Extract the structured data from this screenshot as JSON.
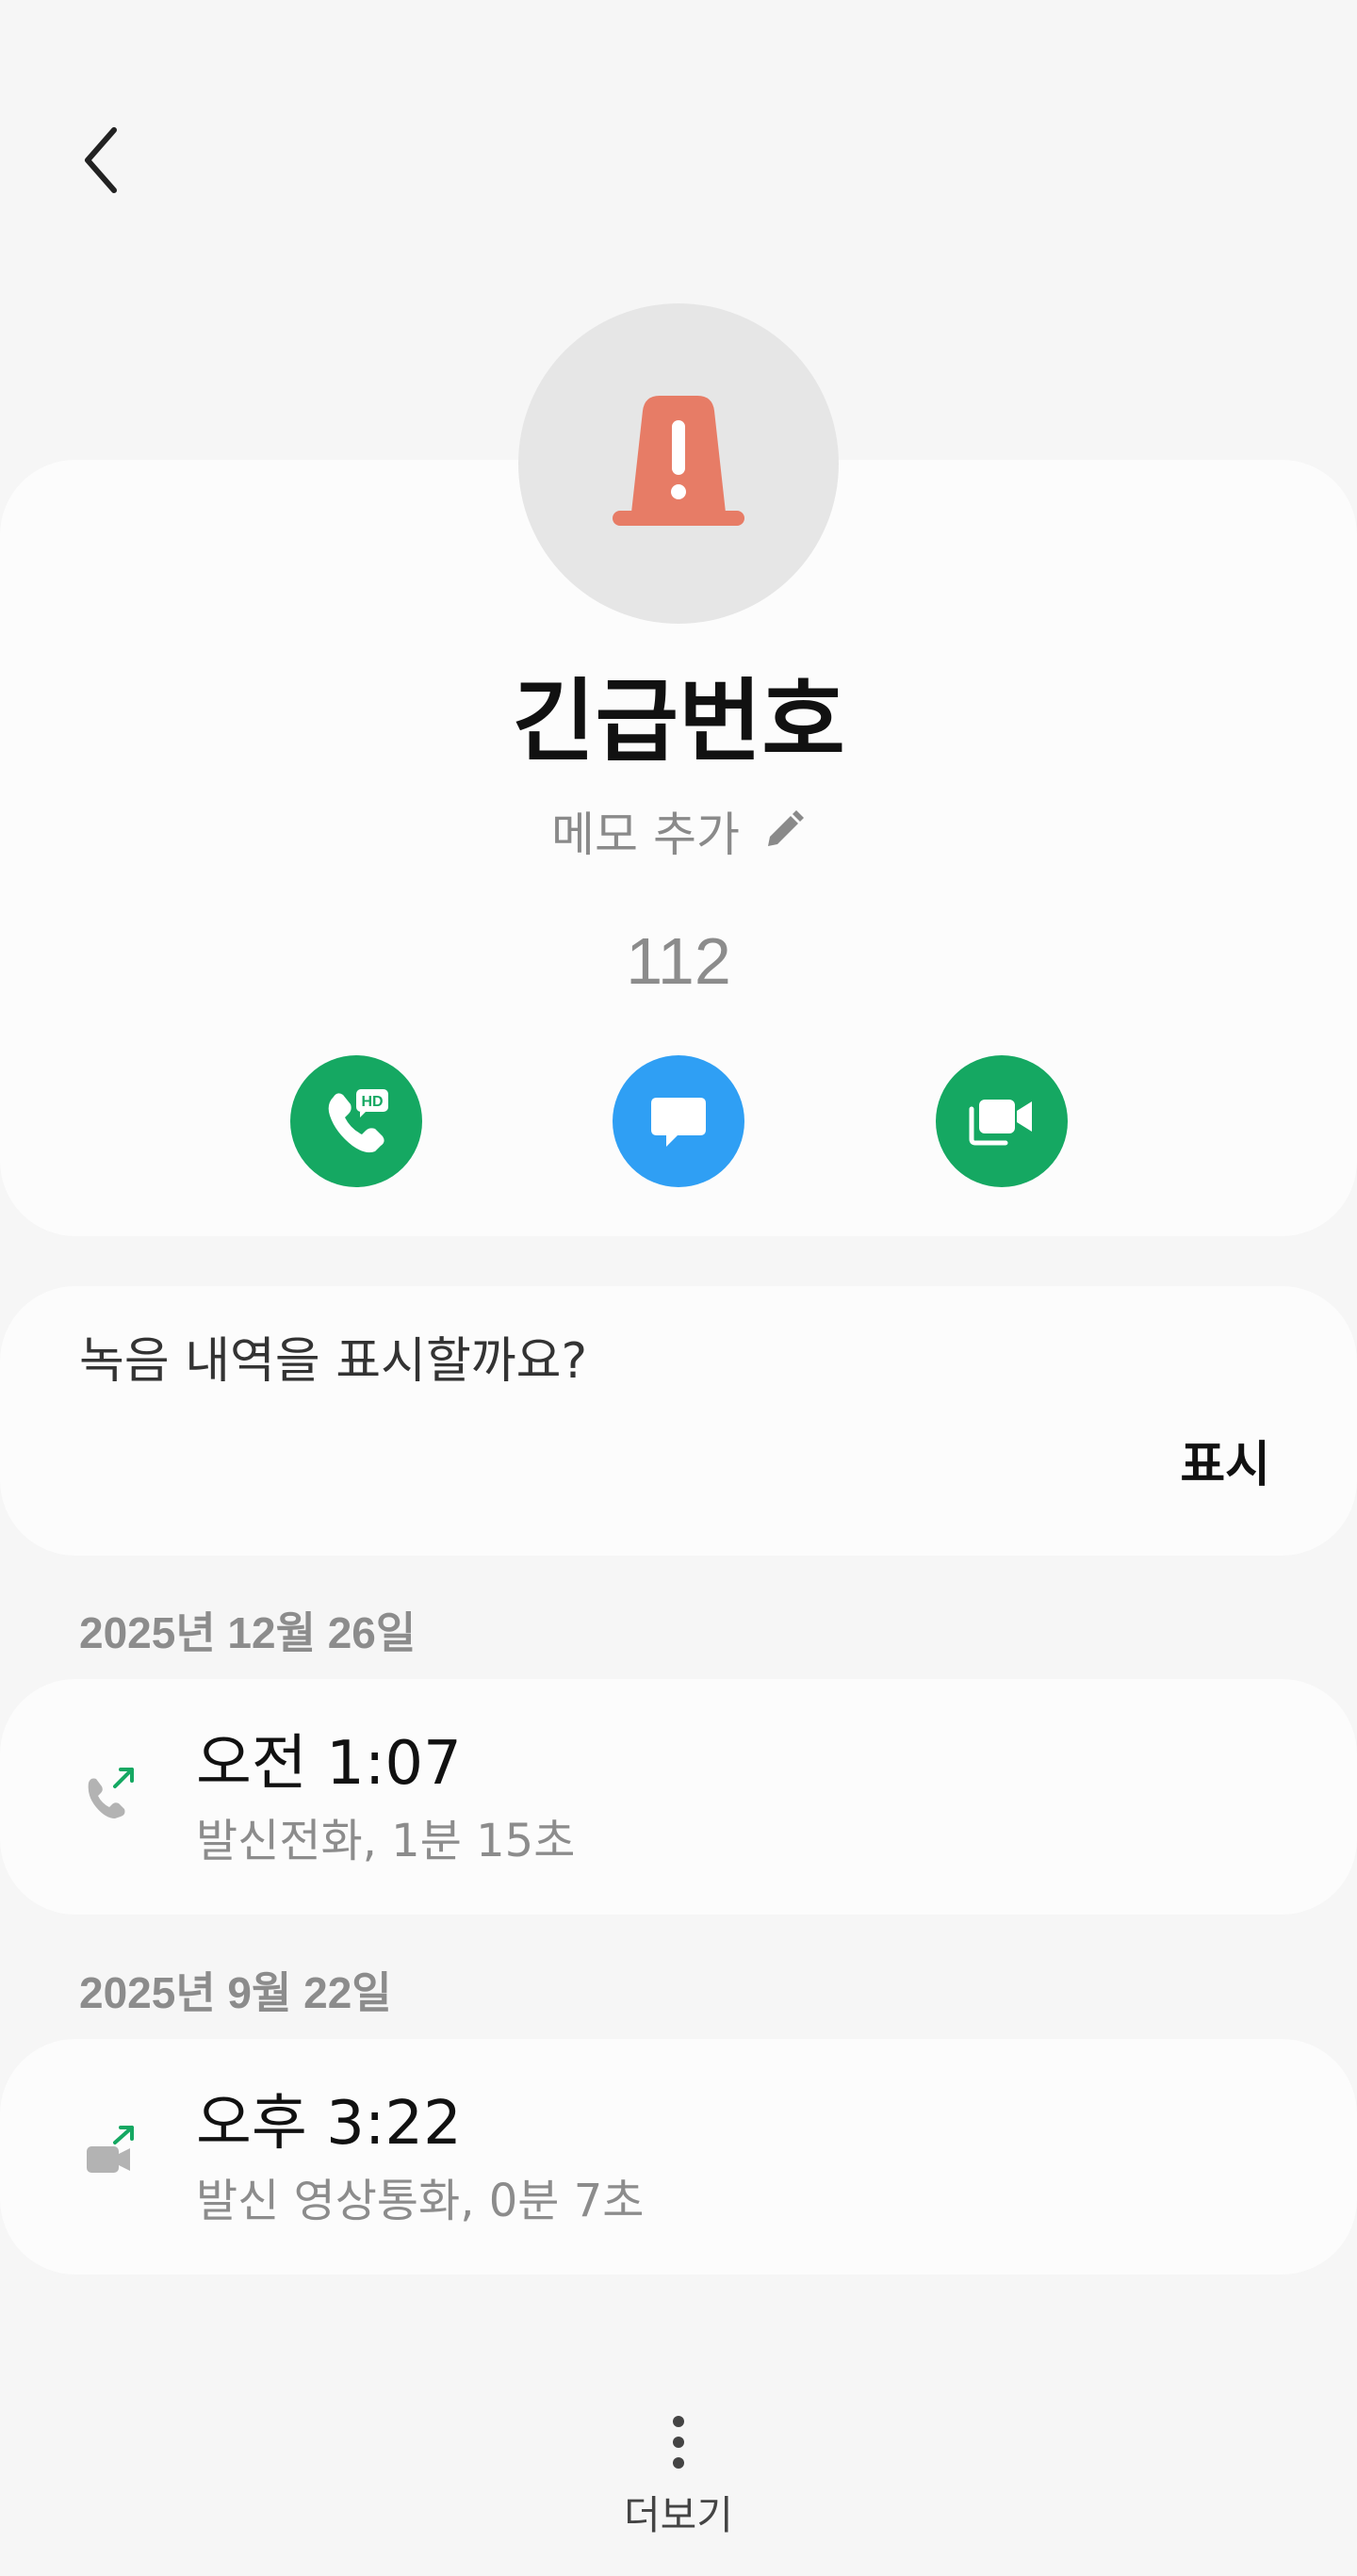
{
  "contact": {
    "name": "긴급번호",
    "memo_label": "메모 추가",
    "number": "112"
  },
  "actions": {
    "call_icon": "hd-voice-call-icon",
    "message_icon": "message-icon",
    "video_icon": "video-call-icon",
    "colors": {
      "call": "#15a862",
      "message": "#2f9ff4",
      "video": "#15a862"
    }
  },
  "recording_prompt": {
    "question": "녹음 내역을 표시할까요?",
    "show_label": "표시"
  },
  "call_log": [
    {
      "date": "2025년 12월 26일",
      "time": "오전 1:07",
      "detail": "발신전화, 1분 15초",
      "icon": "outgoing-call-icon"
    },
    {
      "date": "2025년 9월 22일",
      "time": "오후 3:22",
      "detail": "발신 영상통화, 0분 7초",
      "icon": "outgoing-video-call-icon"
    }
  ],
  "footer": {
    "more_label": "더보기"
  }
}
